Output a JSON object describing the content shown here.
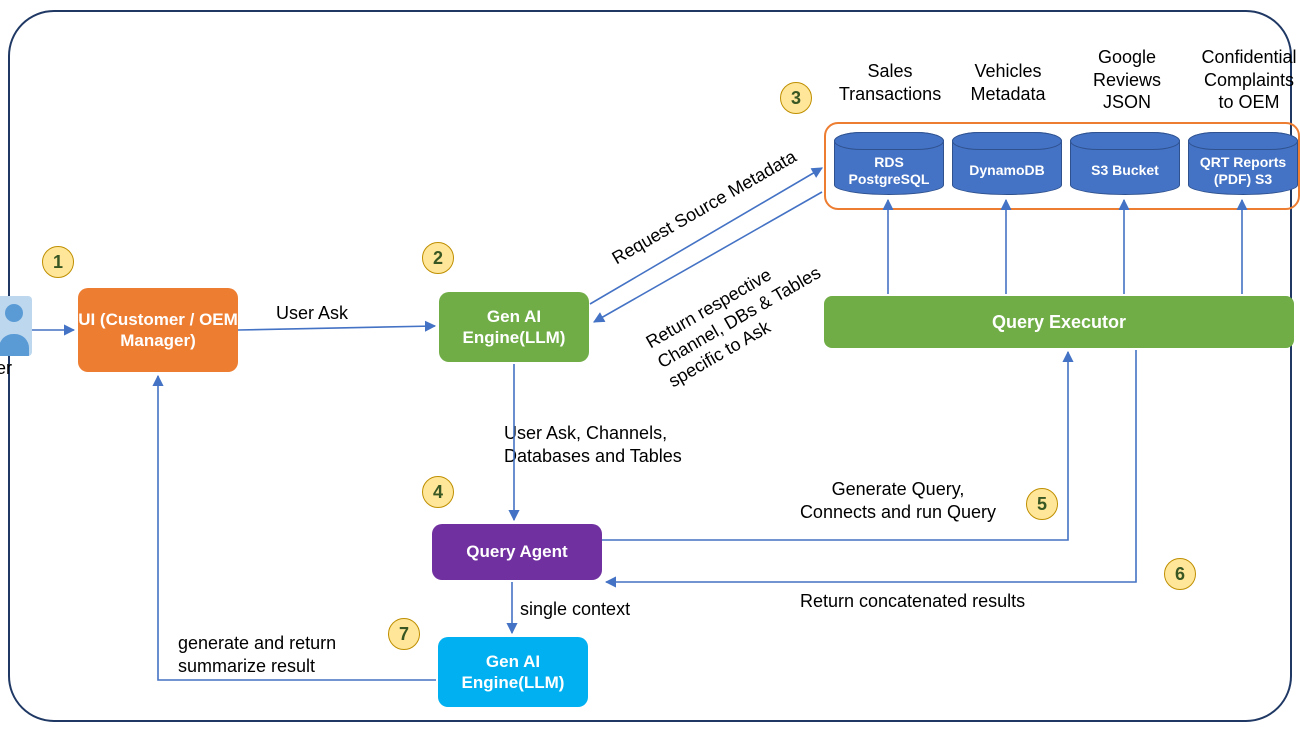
{
  "frame": {},
  "user_label": "er",
  "nodes": {
    "ui": {
      "label": "UI\n(Customer /\nOEM Manager)"
    },
    "gen1": {
      "label": "Gen AI\nEngine(LLM)"
    },
    "qagent": {
      "label": "Query Agent"
    },
    "gen2": {
      "label": "Gen AI\nEngine(LLM)"
    },
    "qexec": {
      "label": "Query Executor"
    }
  },
  "badges": {
    "b1": "1",
    "b2": "2",
    "b3": "3",
    "b4": "4",
    "b5": "5",
    "b6": "6",
    "b7": "7"
  },
  "edges": {
    "user_ask": "User Ask",
    "req_meta": "Request Source Metadata",
    "ret_meta": "Return respective\nChannel, DBs & Tables\nspecific to Ask",
    "down1": "User Ask, Channels,\nDatabases and Tables",
    "genq": "Generate Query,\nConnects and run Query",
    "retcat": "Return concatenated results",
    "single": "single context",
    "summ": "generate and return\nsummarize result"
  },
  "ds": {
    "headers": {
      "h1": "Sales\nTransactions",
      "h2": "Vehicles\nMetadata",
      "h3": "Google\nReviews\nJSON",
      "h4": "Confidential\nComplaints\nto OEM"
    },
    "cyl": {
      "c1": "RDS\nPostgreSQL",
      "c2": "DynamoDB",
      "c3": "S3 Bucket",
      "c4": "QRT Reports\n(PDF) S3"
    }
  }
}
